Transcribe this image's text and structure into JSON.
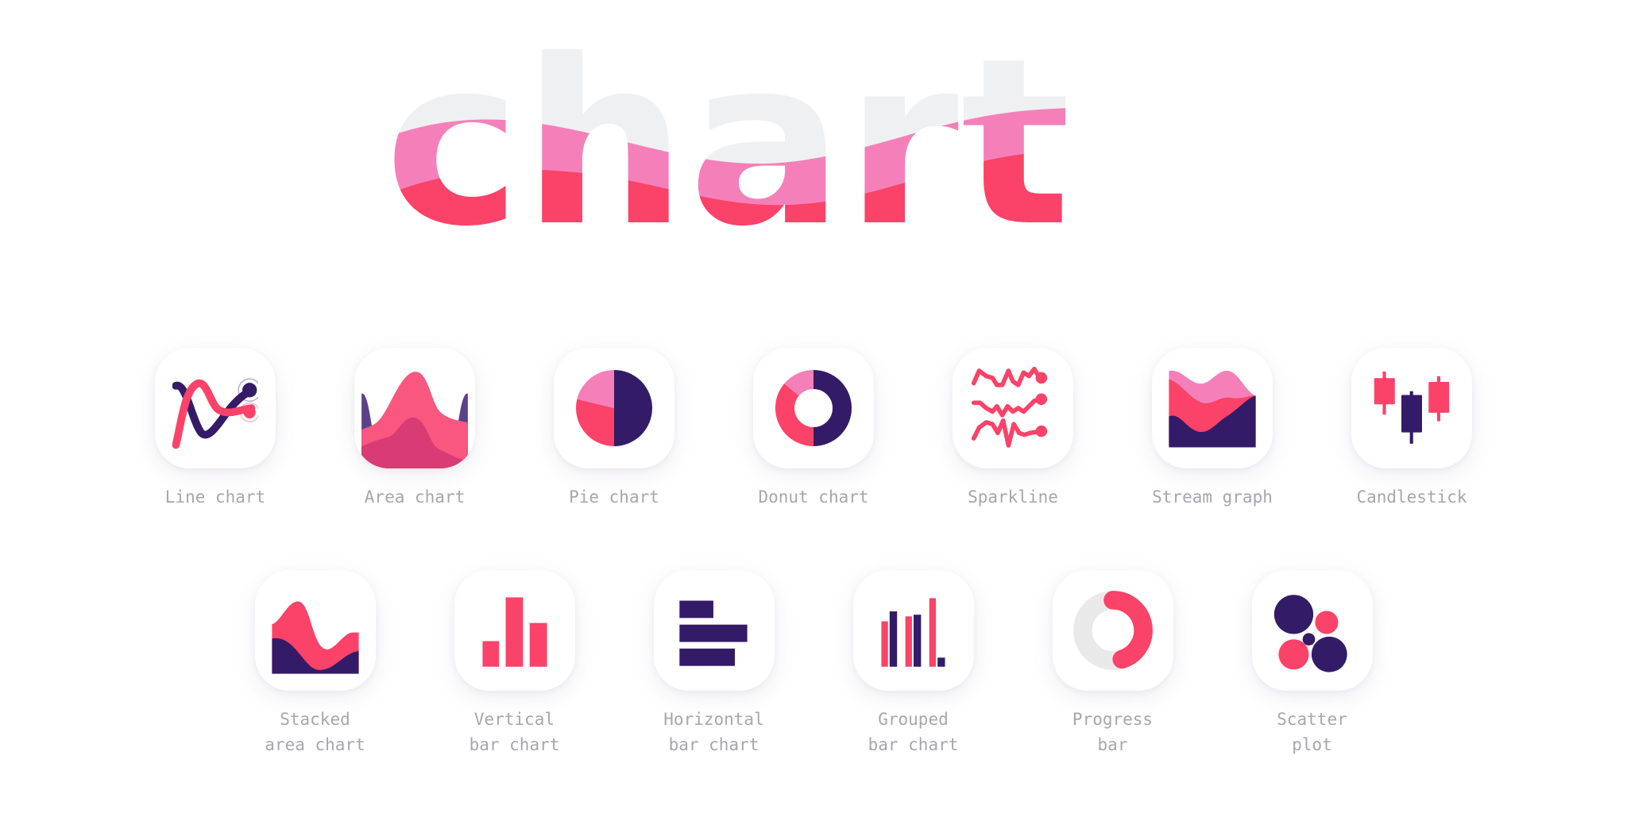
{
  "page": {
    "title": "chart",
    "background": "#ffffff"
  },
  "colors": {
    "pink_light": "#f580b9",
    "pink": "#fb4268",
    "pink_mid": "#f9577f",
    "crimson": "#d93b74",
    "purple": "#341b67",
    "purple_mid": "#5b4189",
    "grey_title": "#eff0f2",
    "grey_track": "#e9e9ea",
    "label_grey": "#a8a6ad",
    "card_white": "#ffffff"
  },
  "rows": [
    {
      "name": "row-one",
      "items": [
        {
          "id": "line-chart",
          "label": "Line chart",
          "icon": "line-chart-icon"
        },
        {
          "id": "area-chart",
          "label": "Area chart",
          "icon": "area-chart-icon"
        },
        {
          "id": "pie-chart",
          "label": "Pie chart",
          "icon": "pie-chart-icon"
        },
        {
          "id": "donut-chart",
          "label": "Donut chart",
          "icon": "donut-chart-icon"
        },
        {
          "id": "sparkline",
          "label": "Sparkline",
          "icon": "sparkline-icon"
        },
        {
          "id": "stream-graph",
          "label": "Stream graph",
          "icon": "stream-graph-icon"
        },
        {
          "id": "candlestick",
          "label": "Candlestick",
          "icon": "candlestick-icon"
        }
      ]
    },
    {
      "name": "row-two",
      "items": [
        {
          "id": "stacked-area-chart",
          "label": "Stacked\narea chart",
          "icon": "stacked-area-chart-icon"
        },
        {
          "id": "vertical-bar-chart",
          "label": "Vertical\nbar chart",
          "icon": "vertical-bar-chart-icon"
        },
        {
          "id": "horizontal-bar-chart",
          "label": "Horizontal\nbar chart",
          "icon": "horizontal-bar-chart-icon"
        },
        {
          "id": "grouped-bar-chart",
          "label": "Grouped\nbar chart",
          "icon": "grouped-bar-chart-icon"
        },
        {
          "id": "progress-bar",
          "label": "Progress\nbar",
          "icon": "progress-bar-icon"
        },
        {
          "id": "scatter-plot",
          "label": "Scatter\nplot",
          "icon": "scatter-plot-icon"
        }
      ]
    }
  ],
  "chart_data": [
    {
      "type": "line",
      "title": "Line chart",
      "series": [
        {
          "name": "purple-line",
          "color": "#341b67",
          "points": [
            [
              4,
              24
            ],
            [
              18,
              46
            ],
            [
              33,
              78
            ],
            [
              48,
              66
            ],
            [
              62,
              50
            ],
            [
              78,
              38
            ],
            [
              92,
              30
            ]
          ]
        },
        {
          "name": "pink-line",
          "color": "#fb4268",
          "points": [
            [
              4,
              88
            ],
            [
              16,
              52
            ],
            [
              30,
              20
            ],
            [
              46,
              42
            ],
            [
              60,
              52
            ],
            [
              76,
              52
            ],
            [
              92,
              50
            ]
          ]
        }
      ],
      "markers": [
        {
          "color": "#341b67",
          "x": 92,
          "y": 30
        },
        {
          "color": "#fb4268",
          "x": 92,
          "y": 50
        }
      ]
    },
    {
      "type": "area",
      "title": "Area chart",
      "series": [
        {
          "name": "purple-band",
          "color": "#5b4189"
        },
        {
          "name": "pink-band",
          "color": "#f9577f"
        },
        {
          "name": "crimson-band",
          "color": "#d93b74"
        }
      ]
    },
    {
      "type": "pie",
      "title": "Pie chart",
      "slices": [
        {
          "name": "slice-1",
          "value": 50,
          "color": "#341b67"
        },
        {
          "name": "slice-2",
          "value": 33,
          "color": "#fb4268"
        },
        {
          "name": "slice-3",
          "value": 17,
          "color": "#f580b9"
        }
      ]
    },
    {
      "type": "pie",
      "title": "Donut chart",
      "donut": true,
      "slices": [
        {
          "name": "slice-1",
          "value": 50,
          "color": "#341b67"
        },
        {
          "name": "slice-2",
          "value": 36,
          "color": "#fb4268"
        },
        {
          "name": "slice-3",
          "value": 14,
          "color": "#f580b9"
        }
      ]
    },
    {
      "type": "line",
      "title": "Sparkline",
      "series": [
        {
          "name": "spark-1",
          "color": "#fb4268",
          "values": [
            55,
            10,
            35,
            25,
            30,
            45,
            40,
            5,
            45,
            20,
            45,
            15,
            25
          ]
        },
        {
          "name": "spark-2",
          "color": "#fb4268",
          "values": [
            10,
            15,
            35,
            45,
            30,
            60,
            35,
            50,
            40,
            45,
            30,
            20,
            15
          ]
        },
        {
          "name": "spark-3",
          "color": "#fb4268",
          "values": [
            60,
            25,
            15,
            20,
            40,
            10,
            85,
            20,
            40,
            45,
            40,
            38,
            35
          ]
        }
      ],
      "endpoint_markers": true
    },
    {
      "type": "area",
      "title": "Stream graph",
      "series": [
        {
          "name": "band-top",
          "color": "#f580b9"
        },
        {
          "name": "band-middle",
          "color": "#fb4268"
        },
        {
          "name": "band-bottom",
          "color": "#341b67"
        }
      ]
    },
    {
      "type": "candlestick",
      "title": "Candlestick",
      "candles": [
        {
          "name": "candle-1",
          "color": "#fb4268",
          "open": 72,
          "close": 40,
          "high": 30,
          "low": 82,
          "direction": "up"
        },
        {
          "name": "candle-2",
          "color": "#341b67",
          "open": 50,
          "close": 88,
          "high": 46,
          "low": 96,
          "direction": "down"
        },
        {
          "name": "candle-3",
          "color": "#fb4268",
          "open": 78,
          "close": 46,
          "high": 40,
          "low": 88,
          "direction": "up"
        }
      ]
    },
    {
      "type": "area",
      "title": "Stacked area chart",
      "series": [
        {
          "name": "pink-layer",
          "color": "#fb4268"
        },
        {
          "name": "purple-layer",
          "color": "#341b67"
        }
      ]
    },
    {
      "type": "bar",
      "title": "Vertical bar chart",
      "orientation": "vertical",
      "categories": [
        "1",
        "2",
        "3"
      ],
      "values": [
        35,
        100,
        62
      ],
      "color": "#fb4268"
    },
    {
      "type": "bar",
      "title": "Horizontal bar chart",
      "orientation": "horizontal",
      "categories": [
        "1",
        "2",
        "3"
      ],
      "values": [
        54,
        100,
        82
      ],
      "color": "#341b67"
    },
    {
      "type": "bar",
      "title": "Grouped bar chart",
      "orientation": "vertical",
      "categories": [
        "1",
        "2",
        "3"
      ],
      "series": [
        {
          "name": "pink-series",
          "color": "#fb4268",
          "values": [
            62,
            74,
            100
          ]
        },
        {
          "name": "purple-series",
          "color": "#341b67",
          "values": [
            82,
            76,
            14
          ]
        }
      ]
    },
    {
      "type": "pie",
      "title": "Progress bar",
      "donut": true,
      "progress_percent": 45,
      "slices": [
        {
          "name": "progress-arc",
          "value": 45,
          "color": "#fb4268"
        },
        {
          "name": "progress-track",
          "value": 55,
          "color": "#e9e9ea"
        }
      ]
    },
    {
      "type": "scatter",
      "title": "Scatter plot",
      "points": [
        {
          "name": "pt-1",
          "x": 30,
          "y": 32,
          "r": 24,
          "color": "#341b67"
        },
        {
          "name": "pt-2",
          "x": 65,
          "y": 42,
          "r": 13,
          "color": "#fb4268"
        },
        {
          "name": "pt-3",
          "x": 46,
          "y": 60,
          "r": 7,
          "color": "#341b67"
        },
        {
          "name": "pt-4",
          "x": 30,
          "y": 78,
          "r": 17,
          "color": "#fb4268"
        },
        {
          "name": "pt-5",
          "x": 68,
          "y": 78,
          "r": 20,
          "color": "#341b67"
        }
      ]
    }
  ]
}
